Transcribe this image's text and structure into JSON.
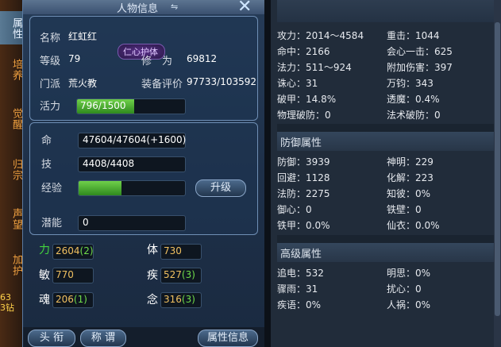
{
  "sidetabs": [
    {
      "label": "属性",
      "active": true
    },
    {
      "label": "培养",
      "active": false
    },
    {
      "label": "觉醒",
      "active": false
    },
    {
      "label": "归宗",
      "active": false
    },
    {
      "label": "声望",
      "active": false
    },
    {
      "label": "加护",
      "active": false
    }
  ],
  "side_numbers": [
    "63",
    "3钻"
  ],
  "window": {
    "title": "人物信息",
    "title_icon": "⇋",
    "close": "✕"
  },
  "info": {
    "name_label": "名称",
    "name": "红虹红",
    "badge": "仁心护体",
    "level_label": "等级",
    "level": "79",
    "cultivation_label": "修　为",
    "cultivation": "69812",
    "faction_label": "门派",
    "faction": "荒火教",
    "gear_label": "装备评价",
    "gear": "97733/103592",
    "vitality_label": "活力",
    "vitality": "796/1500",
    "vitality_fraction": 0.53
  },
  "vitals": {
    "life_label": "命",
    "life": "47604/47604(+1600)",
    "skill_label": "技",
    "skill": "4408/4408",
    "exp_label": "经验",
    "exp_fraction": 0.4,
    "upgrade_button": "升级",
    "potential_label": "潜能",
    "potential": "0"
  },
  "stats": [
    {
      "label": "力",
      "base": "2604",
      "bonus": "(2)",
      "green": true
    },
    {
      "label": "体",
      "base": "730",
      "bonus": "",
      "green": false
    },
    {
      "label": "敏",
      "base": "770",
      "bonus": "",
      "green": false
    },
    {
      "label": "疾",
      "base": "527",
      "bonus": "(3)",
      "green": false
    },
    {
      "label": "魂",
      "base": "206",
      "bonus": "(1)",
      "green": false
    },
    {
      "label": "念",
      "base": "316",
      "bonus": "(3)",
      "green": false
    }
  ],
  "bottom_buttons": [
    "头 衔",
    "称 谓",
    "属性信息"
  ],
  "attack": {
    "rows": [
      [
        "攻力：2014～4584",
        "重击：1044"
      ],
      [
        "命中：2166",
        "会心一击：625"
      ],
      [
        "法力：511～924",
        "附加伤害：397"
      ],
      [
        "诛心：31",
        "万钧：343"
      ],
      [
        "破甲：14.8%",
        "透魔：0.4%"
      ],
      [
        "物理破防：0",
        "法术破防：0"
      ]
    ]
  },
  "defense": {
    "title": "防御属性",
    "rows": [
      [
        "防御：3939",
        "神明：229"
      ],
      [
        "回避：1128",
        "化解：223"
      ],
      [
        "法防：2275",
        "知彼：0%"
      ],
      [
        "御心：0",
        "铁壁：0"
      ],
      [
        "铁甲：0.0%",
        "仙衣：0.0%"
      ]
    ]
  },
  "advanced": {
    "title": "高级属性",
    "rows": [
      [
        "追电：532",
        "明思：0%"
      ],
      [
        "骤雨：31",
        "扰心：0"
      ],
      [
        "疾语：0%",
        "人祸：0%"
      ]
    ]
  }
}
